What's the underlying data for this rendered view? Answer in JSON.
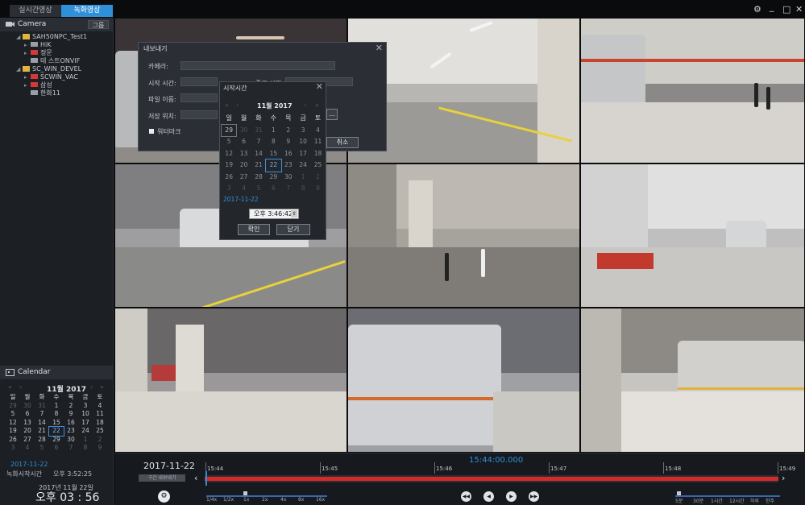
{
  "tabs": {
    "live": "실시간영상",
    "recorded": "녹화영상"
  },
  "window_controls": [
    "⚙",
    "_",
    "□",
    "✕"
  ],
  "camera_panel": {
    "title": "Camera",
    "group_button": "그룹",
    "tree": [
      {
        "label": "SAH50NPC_Test1",
        "type": "folder",
        "level": 0
      },
      {
        "label": "HiK",
        "type": "camera",
        "level": 1
      },
      {
        "label": "정문",
        "type": "camera-red",
        "level": 1
      },
      {
        "label": "테 스트ONVIF",
        "type": "camera",
        "level": 1
      },
      {
        "label": "SC_WIN_DEVEL",
        "type": "folder",
        "level": 0
      },
      {
        "label": "SCWIN_VAC",
        "type": "camera-red",
        "level": 1
      },
      {
        "label": "삼성",
        "type": "camera-red",
        "level": 1
      },
      {
        "label": "한화11",
        "type": "camera",
        "level": 1
      }
    ]
  },
  "calendar_panel": {
    "title": "Calendar",
    "month_label": "11월 2017",
    "weekdays": [
      "일",
      "월",
      "화",
      "수",
      "목",
      "금",
      "토"
    ],
    "days": [
      "29",
      "30",
      "31",
      "1",
      "2",
      "3",
      "4",
      "5",
      "6",
      "7",
      "8",
      "9",
      "10",
      "11",
      "12",
      "13",
      "14",
      "15",
      "16",
      "17",
      "18",
      "19",
      "20",
      "21",
      "22",
      "23",
      "24",
      "25",
      "26",
      "27",
      "28",
      "29",
      "30",
      "1",
      "2",
      "3",
      "4",
      "5",
      "6",
      "7",
      "8",
      "9"
    ],
    "selected_day_index": 24,
    "selected_date": "2017-11-22",
    "recording_start_label": "녹화시작시간",
    "recording_start_value": "오후 3:52:25",
    "clock_date": "2017년 11월 22일",
    "clock_time": "오후 03 : 56"
  },
  "export_dialog": {
    "title": "내보내기",
    "camera_label": "카메라:",
    "start_label": "시작 시간:",
    "end_label": "종료 시간:",
    "filename_label": "파일 이름:",
    "location_label": "저장 위치:",
    "watermark_label": "워터마크",
    "cancel_button": "취소",
    "browse_button": "..."
  },
  "start_picker": {
    "title": "시작시간",
    "month_label": "11월 2017",
    "weekdays": [
      "일",
      "월",
      "화",
      "수",
      "목",
      "금",
      "토"
    ],
    "days": [
      "29",
      "30",
      "31",
      "1",
      "2",
      "3",
      "4",
      "5",
      "6",
      "7",
      "8",
      "9",
      "10",
      "11",
      "12",
      "13",
      "14",
      "15",
      "16",
      "17",
      "18",
      "19",
      "20",
      "21",
      "22",
      "23",
      "24",
      "25",
      "26",
      "27",
      "28",
      "29",
      "30",
      "1",
      "2",
      "3",
      "4",
      "5",
      "6",
      "7",
      "8",
      "9"
    ],
    "selected_date": "2017-11-22",
    "time_value": "오후  3:46:42",
    "ok_button": "확인",
    "close_button": "닫기"
  },
  "timeline": {
    "date": "2017-11-22",
    "current_time": "15:44:00.000",
    "export_button": "구간 내보내기",
    "ticks": [
      "15:44",
      "15:45",
      "15:46",
      "15:47",
      "15:48",
      "15:49"
    ],
    "speed_labels": [
      "1/4x",
      "1/2x",
      "1x",
      "2x",
      "4x",
      "8x",
      "16x"
    ],
    "zoom_labels": [
      "5분",
      "30분",
      "1시간",
      "12시간",
      "하루",
      "한주"
    ],
    "playback_buttons": [
      "prev",
      "back",
      "play",
      "next"
    ]
  },
  "colors": {
    "accent": "#2f8fd9",
    "timeline_bar": "#d42a2a",
    "background": "#1c1f24"
  }
}
